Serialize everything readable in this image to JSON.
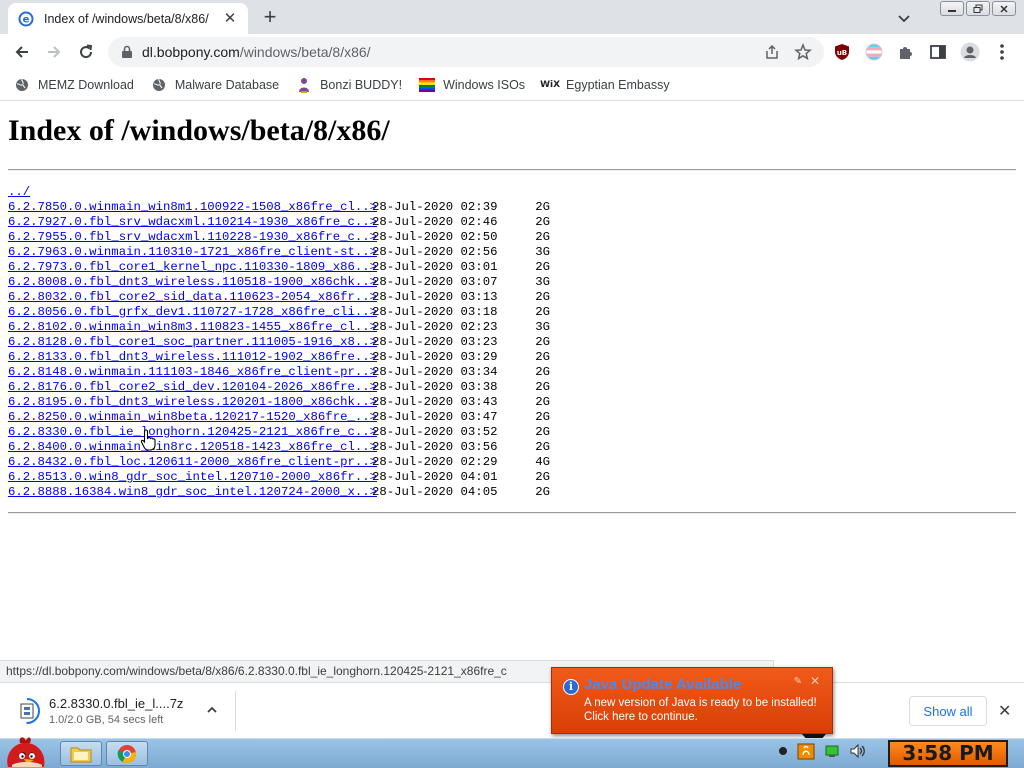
{
  "browser": {
    "tab": {
      "title": "Index of /windows/beta/8/x86/"
    },
    "omnibox": {
      "domain": "dl.bobpony.com",
      "path": "/windows/beta/8/x86/"
    },
    "bookmarks": [
      {
        "label": "MEMZ Download",
        "icon": "globe-icon"
      },
      {
        "label": "Malware Database",
        "icon": "globe-icon"
      },
      {
        "label": "Bonzi BUDDY!",
        "icon": "bonzi-icon"
      },
      {
        "label": "Windows ISOs",
        "icon": "rainbow-flag-icon"
      },
      {
        "label": "Egyptian Embassy",
        "icon": "wix-icon"
      }
    ]
  },
  "page": {
    "heading": "Index of /windows/beta/8/x86/",
    "parent_link": "../",
    "entries": [
      {
        "name": "6.2.7850.0.winmain_win8m1.100922-1508_x86fre_cl..>",
        "date": "28-Jul-2020 02:39",
        "size": "2G"
      },
      {
        "name": "6.2.7927.0.fbl_srv_wdacxml.110214-1930_x86fre_c..>",
        "date": "28-Jul-2020 02:46",
        "size": "2G"
      },
      {
        "name": "6.2.7955.0.fbl_srv_wdacxml.110228-1930_x86fre_c..>",
        "date": "28-Jul-2020 02:50",
        "size": "2G"
      },
      {
        "name": "6.2.7963.0.winmain.110310-1721_x86fre_client-st..>",
        "date": "28-Jul-2020 02:56",
        "size": "3G"
      },
      {
        "name": "6.2.7973.0.fbl_core1_kernel_npc.110330-1809_x86..>",
        "date": "28-Jul-2020 03:01",
        "size": "2G"
      },
      {
        "name": "6.2.8008.0.fbl_dnt3_wireless.110518-1900_x86chk..>",
        "date": "28-Jul-2020 03:07",
        "size": "3G"
      },
      {
        "name": "6.2.8032.0.fbl_core2_sid_data.110623-2054_x86fr..>",
        "date": "28-Jul-2020 03:13",
        "size": "2G"
      },
      {
        "name": "6.2.8056.0.fbl_grfx_dev1.110727-1728_x86fre_cli..>",
        "date": "28-Jul-2020 03:18",
        "size": "2G"
      },
      {
        "name": "6.2.8102.0.winmain_win8m3.110823-1455_x86fre_cl..>",
        "date": "28-Jul-2020 02:23",
        "size": "3G"
      },
      {
        "name": "6.2.8128.0.fbl_core1_soc_partner.111005-1916_x8..>",
        "date": "28-Jul-2020 03:23",
        "size": "2G"
      },
      {
        "name": "6.2.8133.0.fbl_dnt3_wireless.111012-1902_x86fre..>",
        "date": "28-Jul-2020 03:29",
        "size": "2G"
      },
      {
        "name": "6.2.8148.0.winmain.111103-1846_x86fre_client-pr..>",
        "date": "28-Jul-2020 03:34",
        "size": "2G"
      },
      {
        "name": "6.2.8176.0.fbl_core2_sid_dev.120104-2026_x86fre..>",
        "date": "28-Jul-2020 03:38",
        "size": "2G"
      },
      {
        "name": "6.2.8195.0.fbl_dnt3_wireless.120201-1800_x86chk..>",
        "date": "28-Jul-2020 03:43",
        "size": "2G"
      },
      {
        "name": "6.2.8250.0.winmain_win8beta.120217-1520_x86fre_..>",
        "date": "28-Jul-2020 03:47",
        "size": "2G"
      },
      {
        "name": "6.2.8330.0.fbl_ie_longhorn.120425-2121_x86fre_c..>",
        "date": "28-Jul-2020 03:52",
        "size": "2G"
      },
      {
        "name": "6.2.8400.0.winmain_win8rc.120518-1423_x86fre_cl..>",
        "date": "28-Jul-2020 03:56",
        "size": "2G"
      },
      {
        "name": "6.2.8432.0.fbl_loc.120611-2000_x86fre_client-pr..>",
        "date": "28-Jul-2020 02:29",
        "size": "4G"
      },
      {
        "name": "6.2.8513.0.win8_gdr_soc_intel.120710-2000_x86fr..>",
        "date": "28-Jul-2020 04:01",
        "size": "2G"
      },
      {
        "name": "6.2.8888.16384.win8_gdr_soc_intel.120724-2000_x..>",
        "date": "28-Jul-2020 04:05",
        "size": "2G"
      }
    ]
  },
  "status_url": "https://dl.bobpony.com/windows/beta/8/x86/6.2.8330.0.fbl_ie_longhorn.120425-2121_x86fre_c",
  "download": {
    "filename": "6.2.8330.0.fbl_ie_l....7z",
    "status": "1.0/2.0 GB, 54 secs left",
    "show_all": "Show all"
  },
  "java_popup": {
    "title": "Java Update Available",
    "line1": "A new version of Java is ready to be installed!",
    "line2": "Click here to continue."
  },
  "taskbar": {
    "clock": "3:58 PM"
  },
  "colors": {
    "link": "#0000ee",
    "java_orange": "#e8500f",
    "clock_orange": "#f07010",
    "taskbar_blue": "#8fb8de"
  }
}
